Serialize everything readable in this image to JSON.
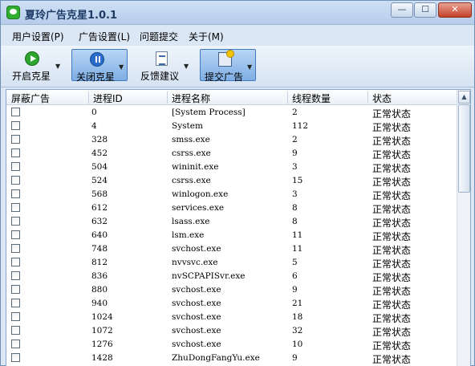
{
  "window": {
    "title": "夏玲广告克星1.0.1"
  },
  "menu": [
    {
      "label": "用户设置(P)"
    },
    {
      "label": "广告设置(L)"
    },
    {
      "label": "问题提交"
    },
    {
      "label": "关于(M)"
    }
  ],
  "toolbar": {
    "start": "开启克星",
    "stop": "关闭克星",
    "feedback": "反馈建议",
    "submit_ad": "提交广告"
  },
  "table": {
    "headers": [
      "屏蔽广告",
      "进程ID",
      "进程名称",
      "线程数量",
      "状态"
    ],
    "rows": [
      {
        "pid": "0",
        "name": "[System Process]",
        "threads": "2",
        "status": "正常状态"
      },
      {
        "pid": "4",
        "name": "System",
        "threads": "112",
        "status": "正常状态"
      },
      {
        "pid": "328",
        "name": "smss.exe",
        "threads": "2",
        "status": "正常状态"
      },
      {
        "pid": "452",
        "name": "csrss.exe",
        "threads": "9",
        "status": "正常状态"
      },
      {
        "pid": "504",
        "name": "wininit.exe",
        "threads": "3",
        "status": "正常状态"
      },
      {
        "pid": "524",
        "name": "csrss.exe",
        "threads": "15",
        "status": "正常状态"
      },
      {
        "pid": "568",
        "name": "winlogon.exe",
        "threads": "3",
        "status": "正常状态"
      },
      {
        "pid": "612",
        "name": "services.exe",
        "threads": "8",
        "status": "正常状态"
      },
      {
        "pid": "632",
        "name": "lsass.exe",
        "threads": "8",
        "status": "正常状态"
      },
      {
        "pid": "640",
        "name": "lsm.exe",
        "threads": "11",
        "status": "正常状态"
      },
      {
        "pid": "748",
        "name": "svchost.exe",
        "threads": "11",
        "status": "正常状态"
      },
      {
        "pid": "812",
        "name": "nvvsvc.exe",
        "threads": "5",
        "status": "正常状态"
      },
      {
        "pid": "836",
        "name": "nvSCPAPISvr.exe",
        "threads": "6",
        "status": "正常状态"
      },
      {
        "pid": "880",
        "name": "svchost.exe",
        "threads": "9",
        "status": "正常状态"
      },
      {
        "pid": "940",
        "name": "svchost.exe",
        "threads": "21",
        "status": "正常状态"
      },
      {
        "pid": "1024",
        "name": "svchost.exe",
        "threads": "18",
        "status": "正常状态"
      },
      {
        "pid": "1072",
        "name": "svchost.exe",
        "threads": "32",
        "status": "正常状态"
      },
      {
        "pid": "1276",
        "name": "svchost.exe",
        "threads": "10",
        "status": "正常状态"
      },
      {
        "pid": "1428",
        "name": "ZhuDongFangYu.exe",
        "threads": "9",
        "status": "正常状态"
      }
    ]
  },
  "icons": {
    "app": "app-logo-icon",
    "start": "play-icon",
    "stop": "pause-icon",
    "feedback": "document-icon",
    "submit": "clipboard-icon"
  },
  "colors": {
    "accent": "#3f79c2",
    "start_green": "#2ea52e",
    "stop_blue": "#2a6cc9"
  }
}
